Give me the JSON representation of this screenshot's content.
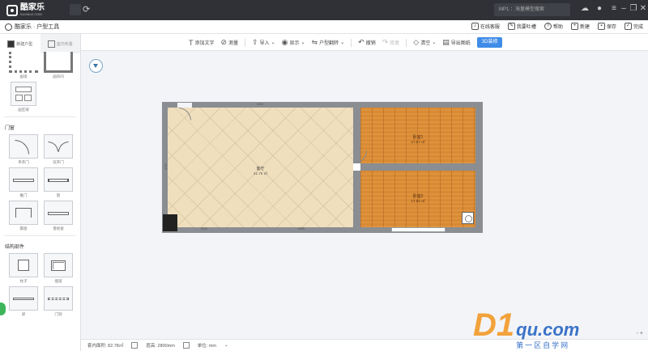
{
  "titlebar": {
    "logo_cn": "酷家乐",
    "logo_en": "KUJIALE.COM",
    "search_placeholder": "MP1 ：海量模型搜索",
    "icons": [
      "cloud-upload-icon",
      "help-icon",
      "menu-icon",
      "minimize-icon",
      "restore-icon",
      "close-icon"
    ]
  },
  "header": {
    "app_title": "酷家乐 · 户型工具",
    "actions": [
      {
        "icon": "service-icon",
        "label": "在线客服"
      },
      {
        "icon": "feedback-icon",
        "label": "我要吐槽"
      },
      {
        "icon": "help-icon",
        "label": "帮助"
      },
      {
        "icon": "new-icon",
        "label": "新建"
      },
      {
        "icon": "save-icon",
        "label": "保存"
      },
      {
        "icon": "done-icon",
        "label": "完成"
      }
    ]
  },
  "toolbar": {
    "tools": [
      {
        "icon": "text-icon",
        "label": "添加文字",
        "disabled": false
      },
      {
        "icon": "measure-icon",
        "label": "测量",
        "disabled": false
      },
      {
        "icon": "import-icon",
        "label": "导入",
        "disabled": false
      },
      {
        "icon": "view-icon",
        "label": "显示",
        "disabled": false
      },
      {
        "icon": "flip-icon",
        "label": "户型翻转",
        "disabled": false
      },
      {
        "icon": "undo-icon",
        "label": "撤销",
        "disabled": false
      },
      {
        "icon": "redo-icon",
        "label": "恢复",
        "disabled": true
      },
      {
        "icon": "clear-icon",
        "label": "清空",
        "disabled": false
      },
      {
        "icon": "export-icon",
        "label": "导出图纸",
        "disabled": false
      }
    ],
    "btn_3d": "3D装修"
  },
  "sidebar": {
    "tabs": [
      {
        "label": "新建户型",
        "active": true
      },
      {
        "label": "室内布置",
        "active": false
      }
    ],
    "top_items": [
      "画墙",
      "画房间",
      "画区域"
    ],
    "sections": [
      {
        "title": "门窗",
        "items": [
          "单开门",
          "双开门",
          "推门",
          "窗",
          "飘窗",
          "落地窗"
        ]
      },
      {
        "title": "结构部件",
        "items": [
          "柱子",
          "烟道",
          "梁",
          "门洞"
        ]
      }
    ]
  },
  "plan": {
    "rooms": [
      {
        "name": "客厅",
        "area": "41.75 ㎡"
      },
      {
        "name": "卧室1",
        "area": "17.57 ㎡"
      },
      {
        "name": "卧室2",
        "area": "17.52 ㎡"
      }
    ],
    "dims": [
      "6916",
      "4100",
      "3316",
      "5055"
    ]
  },
  "status": {
    "area": "套内面积: 82.78㎡",
    "height": "层高: 2800mm",
    "unit": "单位: mm"
  },
  "zoom": "- +",
  "watermark": {
    "d": "D1",
    "domain": "qu.com",
    "sub": "第一区自学网"
  }
}
